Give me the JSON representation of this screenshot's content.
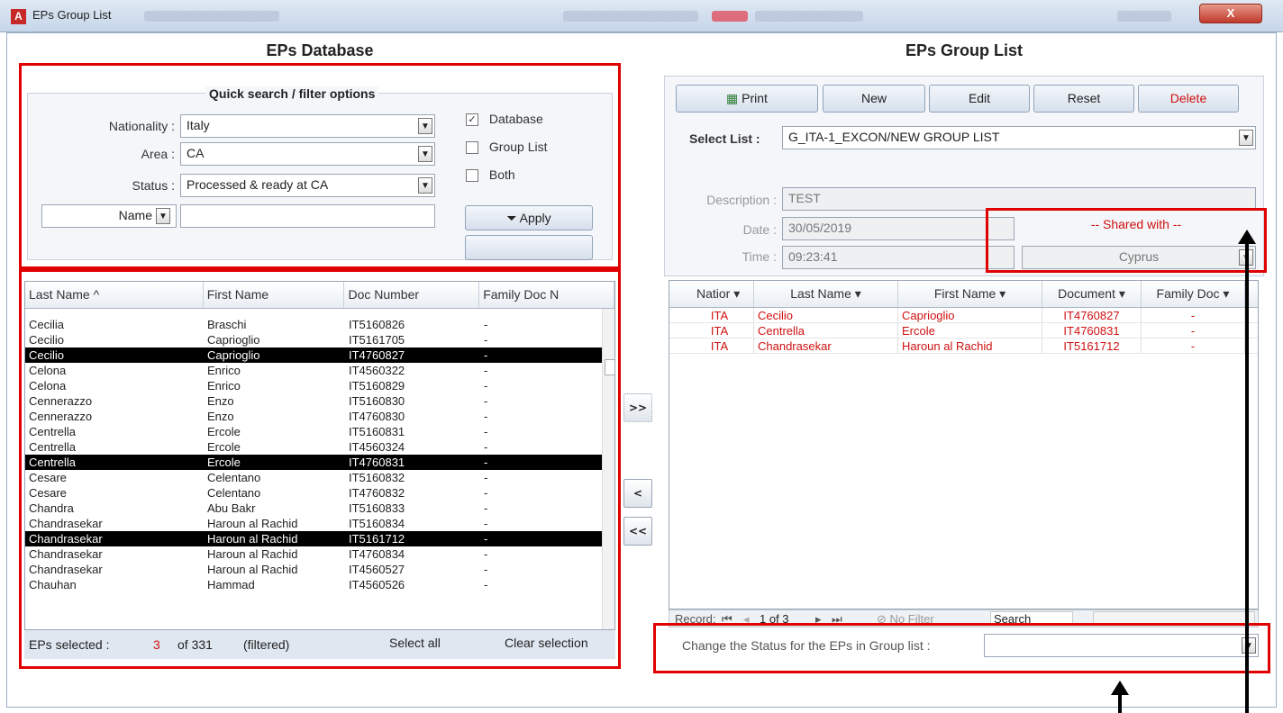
{
  "window": {
    "title": "EPs Group List",
    "close_label": "X"
  },
  "left": {
    "heading": "EPs Database",
    "filter": {
      "legend": "Quick search / filter options",
      "nationality_label": "Nationality :",
      "nationality_value": "Italy",
      "area_label": "Area :",
      "area_value": "CA",
      "status_label": "Status :",
      "status_value": "Processed & ready at CA",
      "name_label": "Name",
      "name_value": "",
      "chk_database": "Database",
      "chk_group": "Group List",
      "chk_both": "Both",
      "apply": "Apply"
    },
    "table": {
      "columns": [
        "Last Name ^",
        "First Name",
        "Doc Number",
        "Family Doc N"
      ],
      "rows": [
        {
          "last": "Cecilia",
          "first": "Braschi",
          "doc": "IT5160826",
          "fam": "-",
          "sel": false
        },
        {
          "last": "Cecilio",
          "first": "Caprioglio",
          "doc": "IT5161705",
          "fam": "-",
          "sel": false
        },
        {
          "last": "Cecilio",
          "first": "Caprioglio",
          "doc": "IT4760827",
          "fam": "-",
          "sel": true
        },
        {
          "last": "Celona",
          "first": "Enrico",
          "doc": "IT4560322",
          "fam": "-",
          "sel": false
        },
        {
          "last": "Celona",
          "first": "Enrico",
          "doc": "IT5160829",
          "fam": "-",
          "sel": false
        },
        {
          "last": "Cennerazzo",
          "first": "Enzo",
          "doc": "IT5160830",
          "fam": "-",
          "sel": false
        },
        {
          "last": "Cennerazzo",
          "first": "Enzo",
          "doc": "IT4760830",
          "fam": "-",
          "sel": false
        },
        {
          "last": "Centrella",
          "first": "Ercole",
          "doc": "IT5160831",
          "fam": "-",
          "sel": false
        },
        {
          "last": "Centrella",
          "first": "Ercole",
          "doc": "IT4560324",
          "fam": "-",
          "sel": false
        },
        {
          "last": "Centrella",
          "first": "Ercole",
          "doc": "IT4760831",
          "fam": "-",
          "sel": true
        },
        {
          "last": "Cesare",
          "first": "Celentano",
          "doc": "IT5160832",
          "fam": "-",
          "sel": false
        },
        {
          "last": "Cesare",
          "first": "Celentano",
          "doc": "IT4760832",
          "fam": "-",
          "sel": false
        },
        {
          "last": "Chandra",
          "first": "Abu Bakr",
          "doc": "IT5160833",
          "fam": "-",
          "sel": false
        },
        {
          "last": "Chandrasekar",
          "first": "Haroun al Rachid",
          "doc": "IT5160834",
          "fam": "-",
          "sel": false
        },
        {
          "last": "Chandrasekar",
          "first": "Haroun al Rachid",
          "doc": "IT5161712",
          "fam": "-",
          "sel": true
        },
        {
          "last": "Chandrasekar",
          "first": "Haroun al Rachid",
          "doc": "IT4760834",
          "fam": "-",
          "sel": false
        },
        {
          "last": "Chandrasekar",
          "first": "Haroun al Rachid",
          "doc": "IT4560527",
          "fam": "-",
          "sel": false
        },
        {
          "last": "Chauhan",
          "first": "Hammad",
          "doc": "IT4560526",
          "fam": "-",
          "sel": false
        }
      ]
    },
    "footer": {
      "selected_label": "EPs selected :",
      "selected_count": "3",
      "of_label": "of 331",
      "filtered": "(filtered)",
      "select_all": "Select all",
      "clear_selection": "Clear selection"
    }
  },
  "move": {
    "add_all": ">>",
    "remove": "<",
    "remove_all": "<<"
  },
  "right": {
    "heading": "EPs Group List",
    "toolbar": {
      "print": "Print",
      "new": "New",
      "edit": "Edit",
      "reset": "Reset",
      "delete": "Delete"
    },
    "select_list_label": "Select List :",
    "select_list_value": "G_ITA-1_EXCON/NEW GROUP LIST",
    "description_label": "Description :",
    "description_value": "TEST",
    "date_label": "Date :",
    "date_value": "30/05/2019",
    "time_label": "Time :",
    "time_value": "09:23:41",
    "shared_heading": "-- Shared with --",
    "shared_value": "Cyprus",
    "table": {
      "columns": [
        "Natior",
        "Last Name",
        "First Name",
        "Document",
        "Family Doc"
      ],
      "rows": [
        {
          "nat": "ITA",
          "last": "Cecilio",
          "first": "Caprioglio",
          "doc": "IT4760827",
          "fam": "-"
        },
        {
          "nat": "ITA",
          "last": "Centrella",
          "first": "Ercole",
          "doc": "IT4760831",
          "fam": "-"
        },
        {
          "nat": "ITA",
          "last": "Chandrasekar",
          "first": "Haroun al Rachid",
          "doc": "IT5161712",
          "fam": "-"
        }
      ]
    },
    "nav": {
      "record_label": "Record:",
      "position": "1 of 3",
      "no_filter": "No Filter",
      "search": "Search"
    },
    "status_change_label": "Change the Status for the EPs in Group list :",
    "status_change_value": ""
  },
  "colors": {
    "highlight": "#e00000",
    "selected_row": "#000000",
    "group_text": "#d01010"
  }
}
